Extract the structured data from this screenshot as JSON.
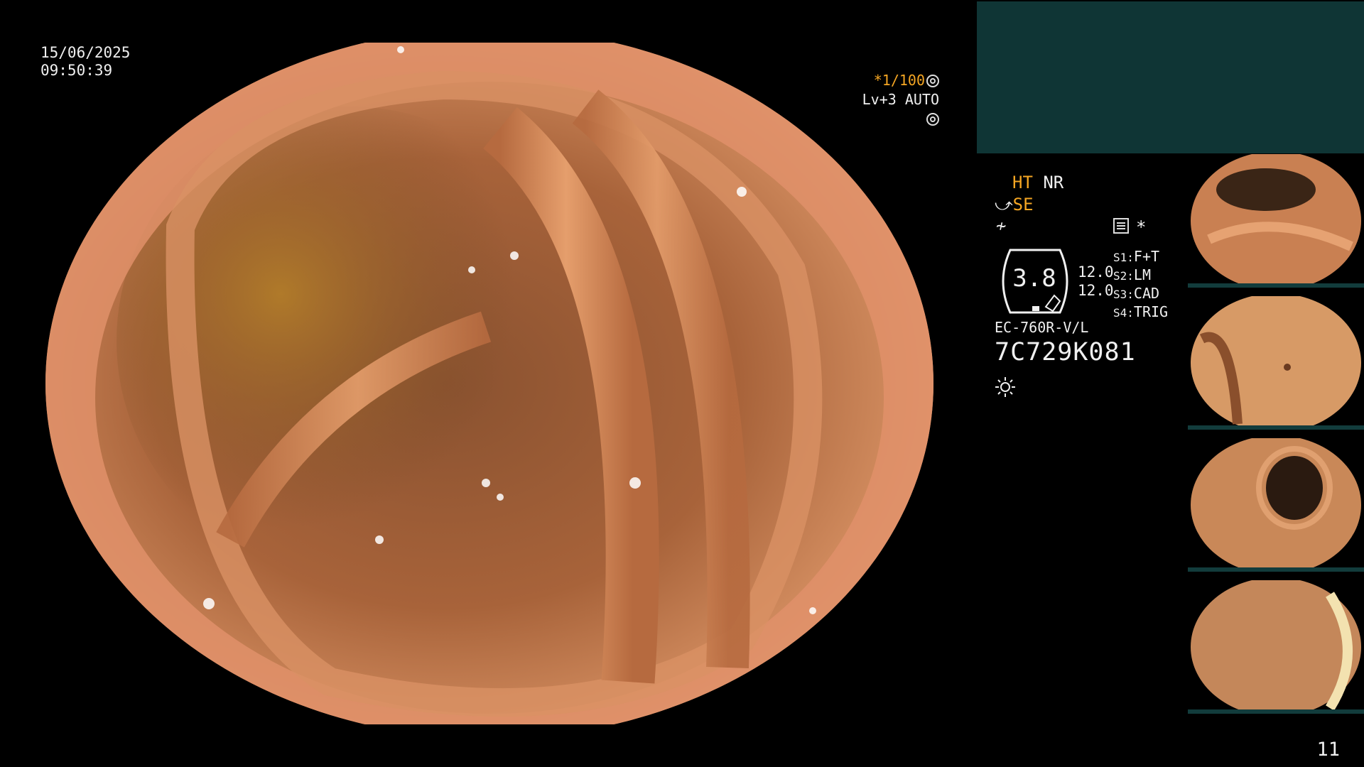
{
  "overlay": {
    "date": "15/06/2025",
    "time": "09:50:39",
    "shutter": "*1/100",
    "level": "Lv+3 AUTO"
  },
  "status": {
    "ht": "HT",
    "nr": "NR",
    "se": "SE",
    "hex_value": "3.8",
    "zoom_a": "12.0",
    "zoom_b": "12.0",
    "s_buttons": [
      {
        "key": "S1:",
        "value": "F+T"
      },
      {
        "key": "S2:",
        "value": "LM"
      },
      {
        "key": "S3:",
        "value": "CAD"
      },
      {
        "key": "S4:",
        "value": "TRIG"
      }
    ],
    "asterisk": "*",
    "model": "EC-760R-V/L",
    "serial": "7C729K081"
  },
  "page_number": "11",
  "colors": {
    "accent_orange": "#f5a623",
    "panel_teal": "#0f3535",
    "tissue": "#c97a4f"
  },
  "icons": [
    "shutter-icon",
    "light-icon",
    "scope-icon",
    "bend-icon",
    "record-icon",
    "sun-icon"
  ]
}
